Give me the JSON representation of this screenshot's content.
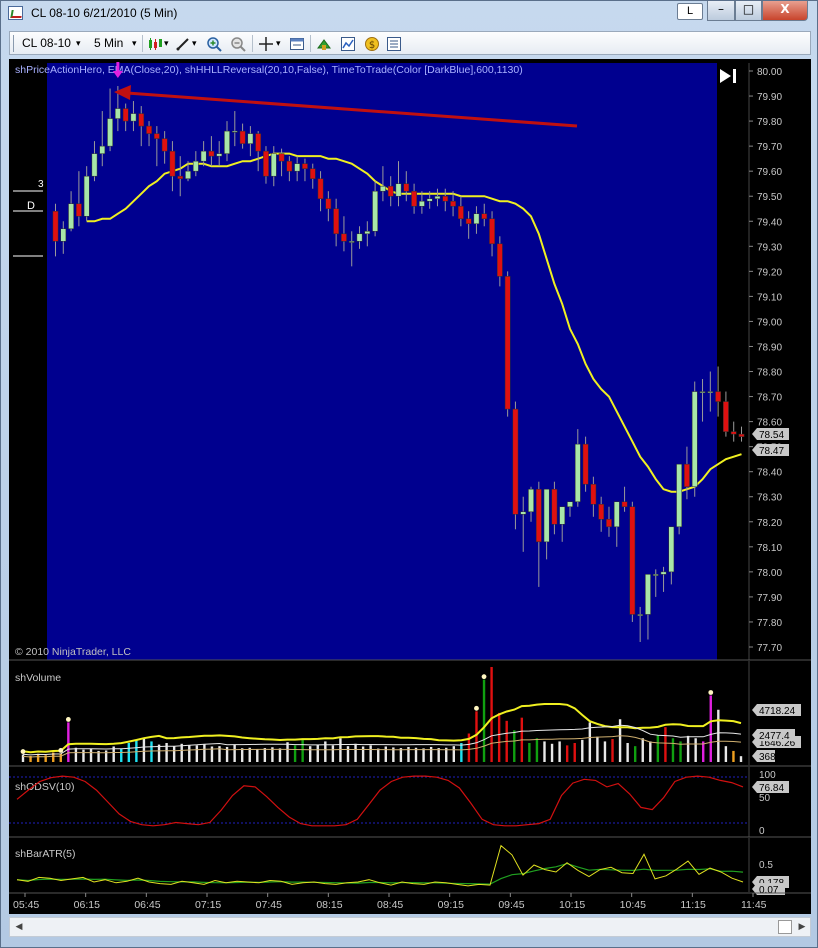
{
  "window": {
    "title": "CL 08-10  6/21/2010 (5 Min)",
    "link_label": "L",
    "minimize_glyph": "–",
    "maximize_glyph": "□",
    "close_glyph": "X"
  },
  "toolbar": {
    "instrument": "CL 08-10",
    "interval": "5 Min",
    "dropdown_glyph": "▾",
    "icons": [
      "bar-type-icon",
      "draw-tool-icon",
      "zoom-in-icon",
      "zoom-out-icon",
      "crosshair-icon",
      "properties-icon",
      "strategy-icon",
      "indicator-icon",
      "hotkey-icon",
      "data-box-icon"
    ]
  },
  "panels": {
    "price": {
      "indicators_label": "shPriceActionHero, EMA(Close,20), shHHLLReversal(20,10,False), TimeToTrade(Color [DarkBlue],600,1130)",
      "copyright": "© 2010 NinjaTrader, LLC",
      "marker_3": "3",
      "marker_D": "D",
      "last_price_label": "78.54",
      "ema_price_label": "78.47"
    },
    "volume": {
      "label": "shVolume",
      "value_1": "4718.24",
      "value_2": "2477.4",
      "value_3": "1646.26",
      "value_4": "368"
    },
    "odsv": {
      "label": "shODSV(10)",
      "value": "76.84",
      "ticks": [
        "100",
        "50",
        "0"
      ]
    },
    "atr": {
      "label": "shBarATR(5)",
      "value_1": "0.178",
      "value_2": "0.07",
      "ticks": [
        "0.5",
        "0"
      ]
    }
  },
  "colors": {
    "session_bg": "#00008f",
    "chart_bg": "#000000",
    "bull_candle": "#a8e6a8",
    "bear_candle": "#e01010",
    "ema": "#f0f020",
    "arrow": "#c01010",
    "signal": "#e020e0",
    "volume_white": "#e8e8e8",
    "volume_green": "#10a010",
    "volume_red": "#e01010",
    "volume_magenta": "#e020e0",
    "volume_cyan": "#20e0f0",
    "volume_orange": "#f0a020",
    "odsv_line": "#d01010",
    "atr_line": "#e0e020",
    "atr_avg": "#20a020"
  },
  "chart_data": [
    {
      "type": "candlestick",
      "title": "CL 08-10 5 Min",
      "x_ticks": [
        "05:45",
        "06:15",
        "06:45",
        "07:15",
        "07:45",
        "08:15",
        "08:45",
        "09:15",
        "09:45",
        "10:15",
        "10:45",
        "11:15",
        "11:45"
      ],
      "y_ticks": [
        "80.00",
        "79.90",
        "79.80",
        "79.70",
        "79.60",
        "79.50",
        "79.40",
        "79.30",
        "79.20",
        "79.10",
        "79.00",
        "78.90",
        "78.80",
        "78.70",
        "78.60",
        "78.50",
        "78.40",
        "78.30",
        "78.20",
        "78.10",
        "78.00",
        "77.90",
        "77.80",
        "77.70"
      ],
      "ylim": [
        77.66,
        80.02
      ],
      "series": [
        {
          "name": "CL 08-10",
          "open": [
            79.44,
            79.32,
            79.37,
            79.47,
            79.42,
            79.58,
            79.67,
            79.7,
            79.81,
            79.85,
            79.8,
            79.83,
            79.78,
            79.75,
            79.73,
            79.68,
            79.58,
            79.57,
            79.6,
            79.64,
            79.68,
            79.66,
            79.67,
            79.76,
            79.76,
            79.71,
            79.75,
            79.68,
            79.58,
            79.67,
            79.64,
            79.6,
            79.63,
            79.61,
            79.57,
            79.49,
            79.45,
            79.35,
            79.32,
            79.32,
            79.35,
            79.36,
            79.52,
            79.54,
            79.5,
            79.55,
            79.52,
            79.46,
            79.48,
            79.49,
            79.5,
            79.48,
            79.46,
            79.41,
            79.39,
            79.43,
            79.41,
            79.31,
            79.18,
            78.65,
            78.23,
            78.24,
            78.33,
            78.12,
            78.33,
            78.19,
            78.26,
            78.28,
            78.51,
            78.35,
            78.27,
            78.21,
            78.18,
            78.28,
            78.26,
            77.83,
            77.83,
            77.99,
            77.99,
            78.0,
            78.18,
            78.43,
            78.34,
            78.72,
            78.72,
            78.72,
            78.68,
            78.56,
            78.55
          ],
          "close": [
            79.32,
            79.37,
            79.47,
            79.42,
            79.58,
            79.67,
            79.7,
            79.81,
            79.85,
            79.8,
            79.83,
            79.78,
            79.75,
            79.73,
            79.68,
            79.58,
            79.57,
            79.6,
            79.64,
            79.68,
            79.66,
            79.67,
            79.76,
            79.76,
            79.71,
            79.75,
            79.68,
            79.58,
            79.67,
            79.64,
            79.6,
            79.63,
            79.61,
            79.57,
            79.49,
            79.45,
            79.35,
            79.32,
            79.32,
            79.35,
            79.36,
            79.52,
            79.54,
            79.5,
            79.55,
            79.52,
            79.46,
            79.48,
            79.49,
            79.5,
            79.48,
            79.46,
            79.41,
            79.39,
            79.43,
            79.41,
            79.31,
            79.18,
            78.65,
            78.23,
            78.24,
            78.33,
            78.12,
            78.33,
            78.19,
            78.26,
            78.28,
            78.51,
            78.35,
            78.27,
            78.21,
            78.18,
            78.28,
            78.26,
            77.83,
            77.83,
            77.99,
            77.99,
            78.0,
            78.18,
            78.43,
            78.34,
            78.72,
            78.72,
            78.72,
            78.68,
            78.56,
            78.55,
            78.54
          ],
          "high": [
            79.47,
            79.4,
            79.52,
            79.6,
            79.62,
            79.72,
            79.84,
            79.93,
            79.94,
            79.87,
            79.88,
            79.86,
            79.8,
            79.78,
            79.76,
            79.72,
            79.66,
            79.64,
            79.68,
            79.72,
            79.74,
            79.72,
            79.8,
            79.84,
            79.79,
            79.78,
            79.76,
            79.7,
            79.7,
            79.69,
            79.66,
            79.66,
            79.65,
            79.63,
            79.6,
            79.52,
            79.49,
            79.42,
            79.36,
            79.38,
            79.4,
            79.56,
            79.62,
            79.58,
            79.64,
            79.6,
            79.55,
            79.52,
            79.52,
            79.53,
            79.53,
            79.52,
            79.5,
            79.44,
            79.46,
            79.47,
            79.44,
            79.34,
            79.2,
            78.68,
            78.3,
            78.34,
            78.36,
            78.14,
            78.36,
            78.22,
            78.28,
            78.57,
            78.54,
            78.38,
            78.3,
            78.26,
            78.26,
            78.34,
            78.28,
            77.86,
            77.88,
            78.01,
            78.02,
            78.06,
            78.24,
            78.5,
            78.76,
            78.77,
            78.8,
            78.82,
            78.72,
            78.6,
            78.58
          ],
          "low": [
            79.26,
            79.27,
            79.36,
            79.38,
            79.4,
            79.56,
            79.62,
            79.68,
            79.76,
            79.76,
            79.76,
            79.7,
            79.7,
            79.62,
            79.63,
            79.52,
            79.5,
            79.56,
            79.58,
            79.62,
            79.62,
            79.62,
            79.64,
            79.7,
            79.69,
            79.66,
            79.6,
            79.55,
            79.54,
            79.58,
            79.56,
            79.56,
            79.56,
            79.53,
            79.44,
            79.4,
            79.3,
            79.28,
            79.22,
            79.29,
            79.3,
            79.34,
            79.48,
            79.46,
            79.46,
            79.48,
            79.43,
            79.43,
            79.45,
            79.46,
            79.44,
            79.42,
            79.38,
            79.33,
            79.35,
            79.38,
            79.26,
            79.14,
            78.62,
            78.17,
            78.08,
            78.2,
            77.94,
            78.05,
            78.15,
            78.12,
            78.22,
            78.26,
            78.32,
            78.22,
            78.16,
            78.14,
            78.1,
            78.24,
            77.8,
            77.72,
            77.73,
            77.9,
            77.92,
            77.95,
            78.15,
            78.29,
            78.3,
            78.6,
            78.64,
            78.62,
            78.54,
            78.52,
            78.52
          ]
        },
        {
          "name": "EMA(Close,20)",
          "values": [
            79.4,
            79.4,
            79.41,
            79.41,
            79.43,
            79.45,
            79.48,
            79.51,
            79.54,
            79.56,
            79.59,
            79.6,
            79.61,
            79.63,
            79.63,
            79.63,
            79.62,
            79.62,
            79.62,
            79.63,
            79.64,
            79.64,
            79.65,
            79.66,
            79.67,
            79.67,
            79.67,
            79.66,
            79.66,
            79.66,
            79.66,
            79.65,
            79.65,
            79.64,
            79.63,
            79.61,
            79.59,
            79.56,
            79.54,
            79.52,
            79.51,
            79.51,
            79.51,
            79.51,
            79.51,
            79.51,
            79.51,
            79.51,
            79.5,
            79.5,
            79.5,
            79.5,
            79.49,
            79.48,
            79.48,
            79.47,
            79.45,
            79.42,
            79.35,
            79.25,
            79.15,
            79.07,
            78.97,
            78.91,
            78.83,
            78.77,
            78.73,
            78.7,
            78.64,
            78.58,
            78.52,
            78.46,
            78.42,
            78.37,
            78.33,
            78.32,
            78.32,
            78.33,
            78.34,
            78.37,
            78.41,
            78.43,
            78.45,
            78.46,
            78.47
          ]
        }
      ],
      "annotations": {
        "signal_arrow_down_at_index": 8,
        "trend_arrow": "red arrow pointing left toward the 79.93 high"
      }
    },
    {
      "type": "bar",
      "title": "shVolume",
      "values": [
        470,
        380,
        520,
        430,
        600,
        540,
        2500,
        900,
        780,
        820,
        700,
        730,
        980,
        850,
        1200,
        1400,
        1500,
        1300,
        1100,
        1200,
        1000,
        1150,
        1050,
        1050,
        1120,
        980,
        1000,
        950,
        1080,
        870,
        900,
        800,
        880,
        930,
        860,
        1250,
        1050,
        1400,
        1000,
        1100,
        1300,
        1050,
        1500,
        1000,
        1150,
        980,
        1050,
        850,
        980,
        920,
        880,
        950,
        900,
        860,
        950,
        880,
        900,
        1000,
        1200,
        1800,
        3200,
        5200,
        6000,
        3100,
        2600,
        2000,
        2800,
        1200,
        1500,
        1300,
        1150,
        1300,
        1050,
        1200,
        1400,
        2500,
        1600,
        1300,
        1450,
        2700,
        1200,
        1000,
        1500,
        1300,
        1700,
        2200,
        1500,
        1300,
        1650,
        1500,
        1300,
        4200,
        3300,
        1000,
        700,
        368
      ],
      "average_line": "yellow",
      "y_labels": [
        "4718.24",
        "2477.4",
        "1646.26",
        "368"
      ]
    },
    {
      "type": "line",
      "title": "shODSV(10)",
      "ylim": [
        0,
        100
      ],
      "y_ticks": [
        "100",
        "50",
        "0"
      ],
      "values": [
        55,
        72,
        88,
        95,
        98,
        96,
        88,
        72,
        50,
        28,
        14,
        8,
        6,
        8,
        12,
        10,
        8,
        12,
        35,
        62,
        80,
        78,
        60,
        40,
        22,
        10,
        6,
        6,
        6,
        8,
        18,
        45,
        72,
        88,
        96,
        98,
        98,
        96,
        90,
        76,
        48,
        18,
        8,
        6,
        6,
        8,
        10,
        18,
        62,
        85,
        92,
        90,
        78,
        84,
        65,
        40,
        36,
        58,
        88,
        96,
        98,
        96,
        90,
        86,
        78
      ]
    },
    {
      "type": "line",
      "title": "shBarATR(5)",
      "ylim": [
        0,
        0.62
      ],
      "y_ticks": [
        "0.5",
        "0"
      ],
      "values": [
        0.12,
        0.1,
        0.15,
        0.14,
        0.11,
        0.13,
        0.15,
        0.09,
        0.12,
        0.08,
        0.1,
        0.14,
        0.09,
        0.07,
        0.06,
        0.1,
        0.08,
        0.06,
        0.11,
        0.08,
        0.1,
        0.09,
        0.08,
        0.11,
        0.1,
        0.06,
        0.08,
        0.09,
        0.07,
        0.06,
        0.08,
        0.09,
        0.12,
        0.08,
        0.05,
        0.09,
        0.07,
        0.06,
        0.09,
        0.08,
        0.06,
        0.04,
        0.06,
        0.05,
        0.56,
        0.44,
        0.18,
        0.31,
        0.25,
        0.22,
        0.34,
        0.24,
        0.16,
        0.25,
        0.28,
        0.21,
        0.2,
        0.45,
        0.13,
        0.17,
        0.26,
        0.36,
        0.19,
        0.27,
        0.22,
        0.14,
        0.09
      ],
      "average_line": "green",
      "y_labels": [
        "0.178",
        "0.07"
      ]
    }
  ]
}
